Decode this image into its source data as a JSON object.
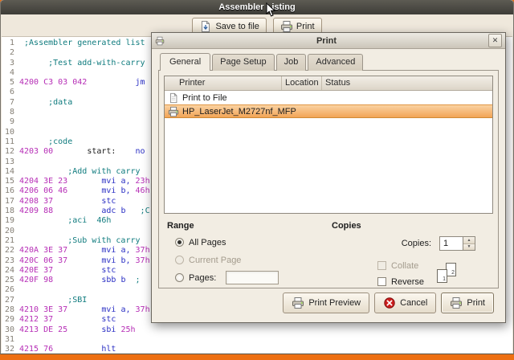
{
  "window": {
    "title": "Assembler Listing",
    "toolbar": {
      "save_label": "Save to file",
      "print_label": "Print"
    }
  },
  "listing": {
    "lines": [
      {
        "n": "1",
        "segs": [
          [
            " ;Assembler generated list",
            "cmt"
          ]
        ]
      },
      {
        "n": "2",
        "segs": []
      },
      {
        "n": "3",
        "segs": [
          [
            "      ;Test add-with-carry",
            "cmt"
          ]
        ]
      },
      {
        "n": "4",
        "segs": []
      },
      {
        "n": "5",
        "segs": [
          [
            "4200 C3 03 042",
            "adr"
          ],
          [
            "          ",
            ""
          ],
          [
            "jm",
            "kw"
          ]
        ]
      },
      {
        "n": "6",
        "segs": []
      },
      {
        "n": "7",
        "segs": [
          [
            "      ;data",
            "cmt"
          ]
        ]
      },
      {
        "n": "8",
        "segs": []
      },
      {
        "n": "9",
        "segs": []
      },
      {
        "n": "10",
        "segs": []
      },
      {
        "n": "11",
        "segs": [
          [
            "      ;code",
            "cmt"
          ]
        ]
      },
      {
        "n": "12",
        "segs": [
          [
            "4203 00",
            "adr"
          ],
          [
            "       ",
            ""
          ],
          [
            "start:",
            "lbl"
          ],
          [
            "    ",
            ""
          ],
          [
            "no",
            "kw"
          ]
        ]
      },
      {
        "n": "13",
        "segs": []
      },
      {
        "n": "14",
        "segs": [
          [
            "          ;Add with carry",
            "cmt"
          ]
        ]
      },
      {
        "n": "15",
        "segs": [
          [
            "4204 3E 23",
            "adr"
          ],
          [
            "       ",
            ""
          ],
          [
            "mvi a, ",
            "kw"
          ],
          [
            "23h",
            "lit"
          ]
        ]
      },
      {
        "n": "16",
        "segs": [
          [
            "4206 06 46",
            "adr"
          ],
          [
            "       ",
            ""
          ],
          [
            "mvi b, ",
            "kw"
          ],
          [
            "46h",
            "lit"
          ]
        ]
      },
      {
        "n": "17",
        "segs": [
          [
            "4208 37",
            "adr"
          ],
          [
            "          ",
            ""
          ],
          [
            "stc",
            "kw"
          ]
        ]
      },
      {
        "n": "18",
        "segs": [
          [
            "4209 88",
            "adr"
          ],
          [
            "          ",
            ""
          ],
          [
            "adc b",
            "kw"
          ],
          [
            "   ",
            ""
          ],
          [
            ";C",
            "cmt"
          ]
        ]
      },
      {
        "n": "19",
        "segs": [
          [
            "          ;aci  46h",
            "cmt"
          ]
        ]
      },
      {
        "n": "20",
        "segs": []
      },
      {
        "n": "21",
        "segs": [
          [
            "          ;Sub with carry",
            "cmt"
          ]
        ]
      },
      {
        "n": "22",
        "segs": [
          [
            "420A 3E 37",
            "adr"
          ],
          [
            "       ",
            ""
          ],
          [
            "mvi a, ",
            "kw"
          ],
          [
            "37h",
            "lit"
          ]
        ]
      },
      {
        "n": "23",
        "segs": [
          [
            "420C 06 37",
            "adr"
          ],
          [
            "       ",
            ""
          ],
          [
            "mvi b, ",
            "kw"
          ],
          [
            "37h",
            "lit"
          ]
        ]
      },
      {
        "n": "24",
        "segs": [
          [
            "420E 37",
            "adr"
          ],
          [
            "          ",
            ""
          ],
          [
            "stc",
            "kw"
          ]
        ]
      },
      {
        "n": "25",
        "segs": [
          [
            "420F 98",
            "adr"
          ],
          [
            "          ",
            ""
          ],
          [
            "sbb b",
            "kw"
          ],
          [
            "  ",
            ""
          ],
          [
            ";",
            "cmt"
          ]
        ]
      },
      {
        "n": "26",
        "segs": []
      },
      {
        "n": "27",
        "segs": [
          [
            "          ;SBI",
            "cmt"
          ]
        ]
      },
      {
        "n": "28",
        "segs": [
          [
            "4210 3E 37",
            "adr"
          ],
          [
            "       ",
            ""
          ],
          [
            "mvi a, ",
            "kw"
          ],
          [
            "37h",
            "lit"
          ]
        ]
      },
      {
        "n": "29",
        "segs": [
          [
            "4212 37",
            "adr"
          ],
          [
            "          ",
            ""
          ],
          [
            "stc",
            "kw"
          ]
        ]
      },
      {
        "n": "30",
        "segs": [
          [
            "4213 DE 25",
            "adr"
          ],
          [
            "       ",
            ""
          ],
          [
            "sbi ",
            "kw"
          ],
          [
            "25h",
            "lit"
          ]
        ]
      },
      {
        "n": "31",
        "segs": []
      },
      {
        "n": "32",
        "segs": [
          [
            "4215 76",
            "adr"
          ],
          [
            "          ",
            ""
          ],
          [
            "hlt",
            "kw"
          ]
        ]
      }
    ]
  },
  "dialog": {
    "title": "Print",
    "tabs": [
      {
        "label": "General",
        "active": true
      },
      {
        "label": "Page Setup",
        "active": false
      },
      {
        "label": "Job",
        "active": false
      },
      {
        "label": "Advanced",
        "active": false
      }
    ],
    "list": {
      "columns": [
        "Printer",
        "Location",
        "Status"
      ],
      "rows": [
        {
          "name": "Print to File",
          "selected": false
        },
        {
          "name": "HP_LaserJet_M2727nf_MFP",
          "selected": true
        }
      ]
    },
    "range": {
      "title": "Range",
      "options": [
        {
          "label": "All Pages",
          "selected": true,
          "disabled": false
        },
        {
          "label": "Current Page",
          "selected": false,
          "disabled": true
        },
        {
          "label": "Pages:",
          "selected": false,
          "disabled": false,
          "input_value": ""
        }
      ]
    },
    "copies": {
      "title": "Copies",
      "label": "Copies:",
      "value": "1",
      "collate": {
        "label": "Collate",
        "checked": false,
        "disabled": true
      },
      "reverse": {
        "label": "Reverse",
        "checked": false,
        "disabled": false
      }
    },
    "buttons": {
      "preview": "Print Preview",
      "cancel": "Cancel",
      "print": "Print"
    }
  },
  "colors": {
    "desktop_orange": "#ED6F12",
    "selection_orange": "#F2A456",
    "titlebar_gray": "#3E3D38"
  }
}
